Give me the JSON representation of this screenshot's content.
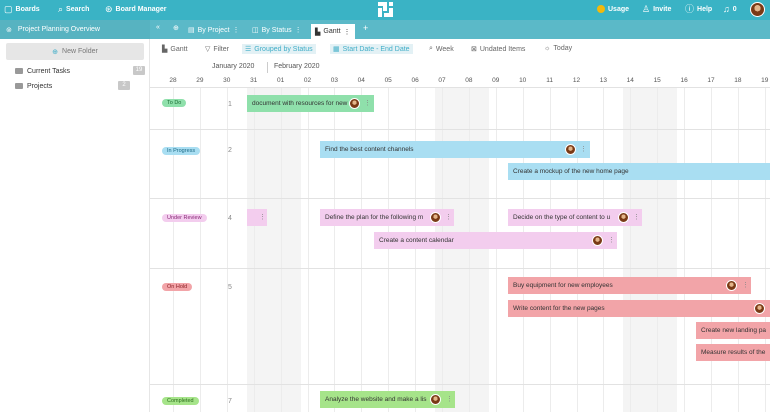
{
  "topbar": {
    "boards": "Boards",
    "search": "Search",
    "board_manager": "Board Manager",
    "usage": "Usage",
    "invite": "Invite",
    "help": "Help",
    "notifications": "0"
  },
  "subbar": {
    "board_title": "Project Planning Overview",
    "collapse": "«",
    "views": [
      "By Project",
      "By Status",
      "Gantt"
    ],
    "add": "+"
  },
  "sidebar": {
    "new_folder": "New Folder",
    "folders": [
      {
        "label": "Current Tasks",
        "count": "19"
      },
      {
        "label": "Projects",
        "count": "2"
      }
    ]
  },
  "toolbar": {
    "gantt": "Gantt",
    "filter": "Filter",
    "grouped": "Grouped by Status",
    "dates": "Start Date - End Date",
    "week": "Week",
    "undated": "Undated Items",
    "today": "Today"
  },
  "timeline": {
    "months": [
      "January 2020",
      "February 2020"
    ],
    "days": [
      "28",
      "29",
      "30",
      "31",
      "01",
      "02",
      "03",
      "04",
      "05",
      "06",
      "07",
      "08",
      "09",
      "10",
      "11",
      "12",
      "13",
      "14",
      "15",
      "16",
      "17",
      "18",
      "19"
    ],
    "groups": [
      {
        "label": "To Do",
        "count": "1"
      },
      {
        "label": "In Progress",
        "count": "2"
      },
      {
        "label": "Under Review",
        "count": "4"
      },
      {
        "label": "On Hold",
        "count": "5"
      },
      {
        "label": "Completed",
        "count": "7"
      }
    ],
    "tasks": [
      "document with resources for new",
      "Find the best content channels",
      "Create a mockup of the new home page",
      "Define the plan for the following m",
      "Decide on the type of content to u",
      "Create a content calendar",
      "Buy equipment for new employees",
      "Write content for the new pages",
      "Create new landing pa",
      "Measure results of the",
      "Analyze the website and make a lis"
    ]
  },
  "colors": {
    "topbar": "#3ab3c5",
    "todo": "#8fe0ab",
    "in_progress": "#a9def2",
    "under_review": "#f3cdee",
    "on_hold": "#f2a4a8",
    "completed": "#a6e48a"
  }
}
